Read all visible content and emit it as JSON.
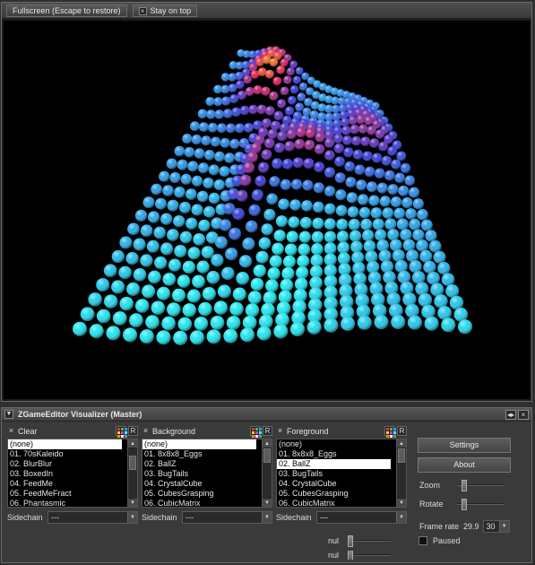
{
  "viewer": {
    "fullscreen_label": "Fullscreen (Escape to restore)",
    "stay_on_top_label": "Stay on top"
  },
  "panel": {
    "title": "ZGameEditor Visualizer (Master)"
  },
  "columns": [
    {
      "title": "Clear",
      "items": [
        "(none)",
        "01. 70sKaleido",
        "02. BlurBlur",
        "03. BoxedIn",
        "04. FeedMe",
        "05. FeedMeFract",
        "06. Phantasmic"
      ],
      "selected_index": 0,
      "sidechain_label": "Sidechain",
      "sidechain_value": "---"
    },
    {
      "title": "Background",
      "items": [
        "(none)",
        "01. 8x8x8_Eggs",
        "02. BallZ",
        "03. BugTails",
        "04. CrystalCube",
        "05. CubesGrasping",
        "06. CubicMatrix"
      ],
      "selected_index": 0,
      "sidechain_label": "Sidechain",
      "sidechain_value": "---"
    },
    {
      "title": "Foreground",
      "items": [
        "(none)",
        "01. 8x8x8_Eggs",
        "02. BallZ",
        "03. BugTails",
        "04. CrystalCube",
        "05. CubesGrasping",
        "06. CubicMatrix"
      ],
      "selected_index": 2,
      "sidechain_label": "Sidechain",
      "sidechain_value": "---"
    }
  ],
  "controls": {
    "settings_label": "Settings",
    "about_label": "About",
    "zoom_label": "Zoom",
    "zoom_level": 0.1,
    "rotate_label": "Rotate",
    "rotate_level": 0.1,
    "frame_rate_label": "Frame rate",
    "frame_rate_value": "29.9",
    "frame_rate_setting": "30",
    "paused_label": "Paused",
    "param_label_1": "nul",
    "param_label_2": "nul"
  },
  "icons": {
    "panel_menu": "dropdown-icon",
    "panel_nav": "arrows-icon",
    "panel_close": "close-icon",
    "preset_grid": "color-grid-icon",
    "random": "R"
  },
  "colors": {
    "gradient_low": "#22e6f0",
    "gradient_mid": "#3a3ad8",
    "gradient_high": "#e0205a",
    "gradient_peak": "#f07a20"
  }
}
